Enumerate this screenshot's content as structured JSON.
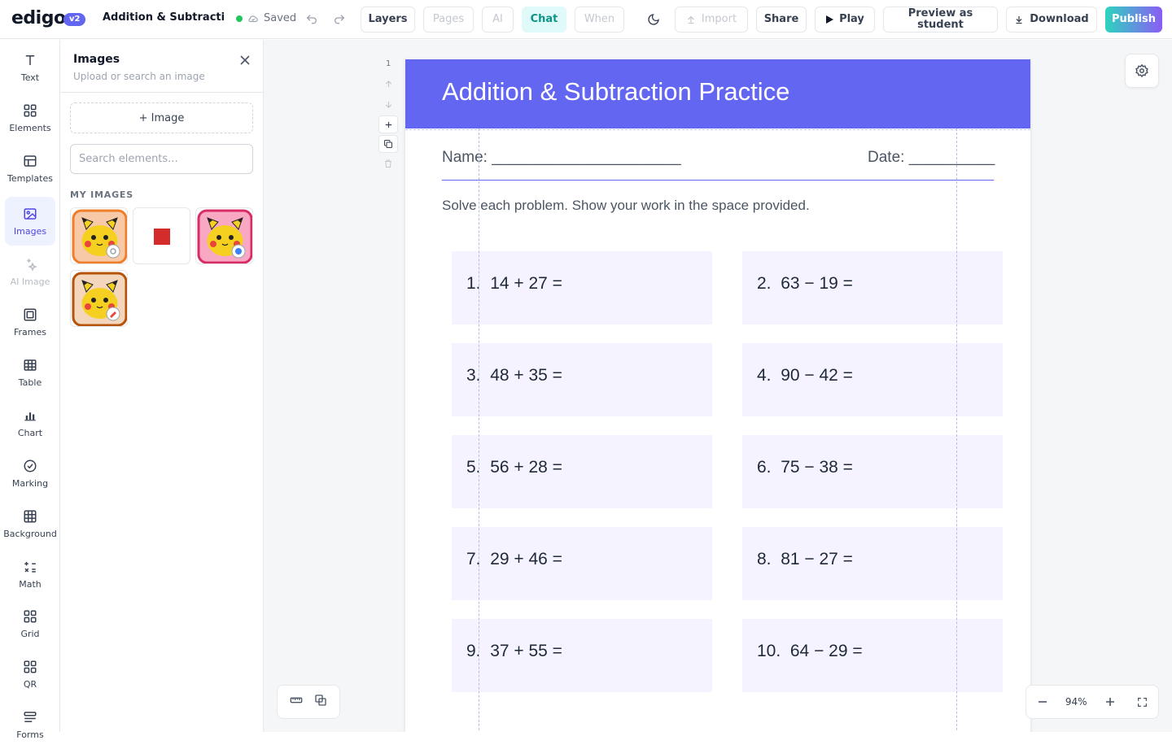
{
  "app": {
    "logo": "edigo",
    "version": "v2",
    "doc_title": "Addition & Subtraction Practice",
    "save_status": "Saved"
  },
  "toolbar": {
    "layers": "Layers",
    "pages": "Pages",
    "ai": "AI",
    "chat": "Chat",
    "when": "When",
    "import": "Import",
    "share": "Share",
    "play": "Play",
    "preview": "Preview as student",
    "download": "Download",
    "publish": "Publish"
  },
  "rail": [
    {
      "label": "Text",
      "icon": "text-icon"
    },
    {
      "label": "Elements",
      "icon": "elements-icon"
    },
    {
      "label": "Templates",
      "icon": "templates-icon"
    },
    {
      "label": "Images",
      "icon": "image-icon",
      "active": true
    },
    {
      "label": "AI Image",
      "icon": "sparkle-icon",
      "disabled": true
    },
    {
      "label": "Frames",
      "icon": "frame-icon"
    },
    {
      "label": "Table",
      "icon": "table-icon"
    },
    {
      "label": "Chart",
      "icon": "chart-icon"
    },
    {
      "label": "Marking",
      "icon": "check-circle-icon"
    },
    {
      "label": "Background",
      "icon": "grid-icon"
    },
    {
      "label": "Math",
      "icon": "math-icon"
    },
    {
      "label": "Grid",
      "icon": "grid-squares-icon"
    },
    {
      "label": "QR",
      "icon": "qr-icon"
    },
    {
      "label": "Forms",
      "icon": "forms-icon"
    }
  ],
  "images_panel": {
    "title": "Images",
    "subtitle": "Upload or search an image",
    "add_button": "+ Image",
    "search_placeholder": "Search elements...",
    "section_title": "MY IMAGES",
    "items": [
      {
        "kind": "pikachu-orange",
        "name": "pikachu-avatar-image"
      },
      {
        "kind": "red-square",
        "name": "red-square-image"
      },
      {
        "kind": "pikachu-pink",
        "name": "pikachu-pink-avatar-image"
      },
      {
        "kind": "pikachu-brown",
        "name": "pikachu-brown-avatar-image"
      }
    ]
  },
  "page_tools": {
    "page_number": "1"
  },
  "worksheet": {
    "title": "Addition & Subtraction Practice",
    "name_label": "Name: ______________________",
    "date_label": "Date: __________",
    "instructions": "Solve each problem. Show your work in the space provided.",
    "problems": [
      {
        "num": "1.",
        "expr": "14 + 27 ="
      },
      {
        "num": "2.",
        "expr": "63 − 19 ="
      },
      {
        "num": "3.",
        "expr": "48 + 35 ="
      },
      {
        "num": "4.",
        "expr": "90 − 42 ="
      },
      {
        "num": "5.",
        "expr": "56 + 28 ="
      },
      {
        "num": "6.",
        "expr": "75 − 38 ="
      },
      {
        "num": "7.",
        "expr": "29 + 46 ="
      },
      {
        "num": "8.",
        "expr": "81 − 27 ="
      },
      {
        "num": "9.",
        "expr": "37 + 55 ="
      },
      {
        "num": "10.",
        "expr": "64 − 29 ="
      }
    ]
  },
  "zoom": {
    "level": "94%"
  },
  "colors": {
    "accent": "#6366f1",
    "chat": "#0d9488",
    "saved": "#22c55e"
  }
}
